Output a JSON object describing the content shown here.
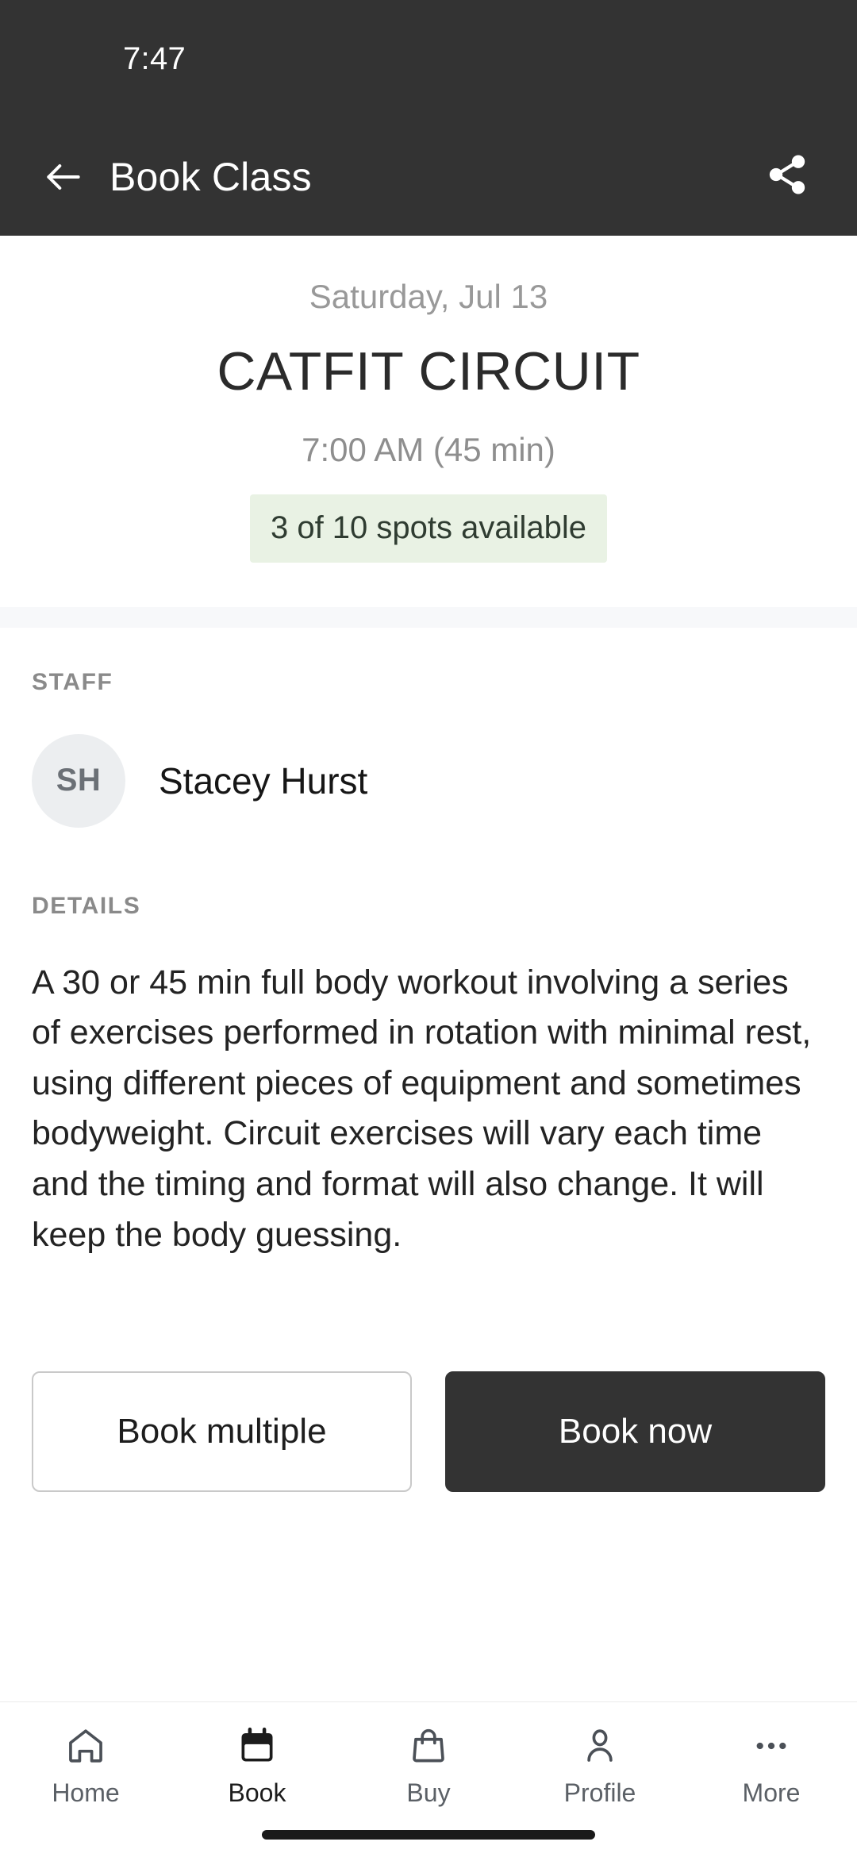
{
  "status_bar": {
    "time": "7:47"
  },
  "app_bar": {
    "title": "Book Class",
    "back_icon": "arrow-left-icon",
    "share_icon": "share-icon"
  },
  "hero": {
    "date": "Saturday, Jul 13",
    "class_name": "CATFIT CIRCUIT",
    "time": "7:00 AM (45 min)",
    "spots": "3 of 10 spots available",
    "spots_count": 3,
    "spots_total": 10,
    "spots_bg_color": "#e9f2e4",
    "spots_text_color": "#2f3c31"
  },
  "staff": {
    "label": "STAFF",
    "initials": "SH",
    "name": "Stacey Hurst"
  },
  "details": {
    "label": "DETAILS",
    "body": "A 30 or 45 min full body workout involving a series of exercises performed in rotation with minimal rest, using different pieces of equipment and sometimes bodyweight. Circuit exercises will vary each time and the timing and format will also change. It will keep the body guessing."
  },
  "actions": {
    "book_multiple": "Book multiple",
    "book_now": "Book now"
  },
  "bottom_nav": {
    "items": [
      {
        "label": "Home",
        "icon": "home-icon",
        "active": false
      },
      {
        "label": "Book",
        "icon": "calendar-icon",
        "active": true
      },
      {
        "label": "Buy",
        "icon": "bag-icon",
        "active": false
      },
      {
        "label": "Profile",
        "icon": "person-icon",
        "active": false
      },
      {
        "label": "More",
        "icon": "more-dots-icon",
        "active": false
      }
    ]
  },
  "theme": {
    "header_bg": "#333333",
    "primary_button": "#333333",
    "page_bg": "#ffffff"
  }
}
